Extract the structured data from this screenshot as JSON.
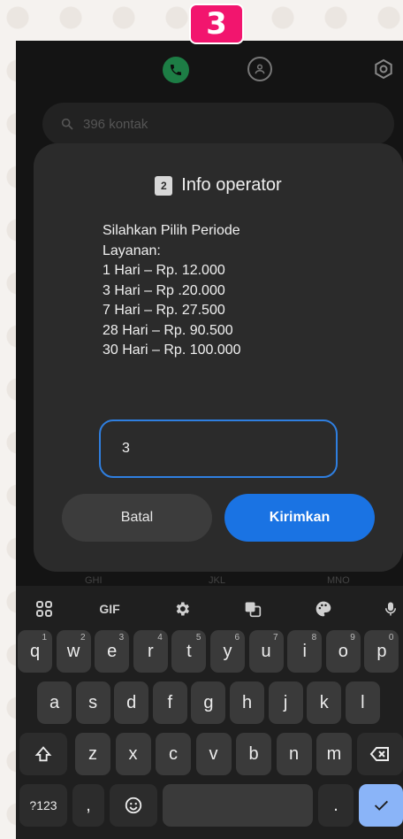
{
  "step_badge": "3",
  "app": {
    "search_placeholder": "396 kontak",
    "bg_key_labels": [
      "GHI",
      "JKL",
      "MNO"
    ]
  },
  "dialog": {
    "sim_number": "2",
    "title": "Info operator",
    "message_lines": [
      "Silahkan Pilih Periode",
      "Layanan:",
      "1 Hari – Rp. 12.000",
      "3 Hari – Rp .20.000",
      "7 Hari – Rp. 27.500",
      "28 Hari – Rp. 90.500",
      "30 Hari – Rp. 100.000"
    ],
    "input_value": "3",
    "cancel_label": "Batal",
    "send_label": "Kirimkan"
  },
  "keyboard": {
    "gif_label": "GIF",
    "row1": [
      {
        "k": "q",
        "h": "1"
      },
      {
        "k": "w",
        "h": "2"
      },
      {
        "k": "e",
        "h": "3"
      },
      {
        "k": "r",
        "h": "4"
      },
      {
        "k": "t",
        "h": "5"
      },
      {
        "k": "y",
        "h": "6"
      },
      {
        "k": "u",
        "h": "7"
      },
      {
        "k": "i",
        "h": "8"
      },
      {
        "k": "o",
        "h": "9"
      },
      {
        "k": "p",
        "h": "0"
      }
    ],
    "row2": [
      "a",
      "s",
      "d",
      "f",
      "g",
      "h",
      "j",
      "k",
      "l"
    ],
    "row3": [
      "z",
      "x",
      "c",
      "v",
      "b",
      "n",
      "m"
    ],
    "symbols_label": "?123",
    "comma_label": ",",
    "period_label": "."
  },
  "colors": {
    "badge": "#f2156e",
    "accent": "#1a73e3",
    "call_green": "#1d7d45"
  }
}
